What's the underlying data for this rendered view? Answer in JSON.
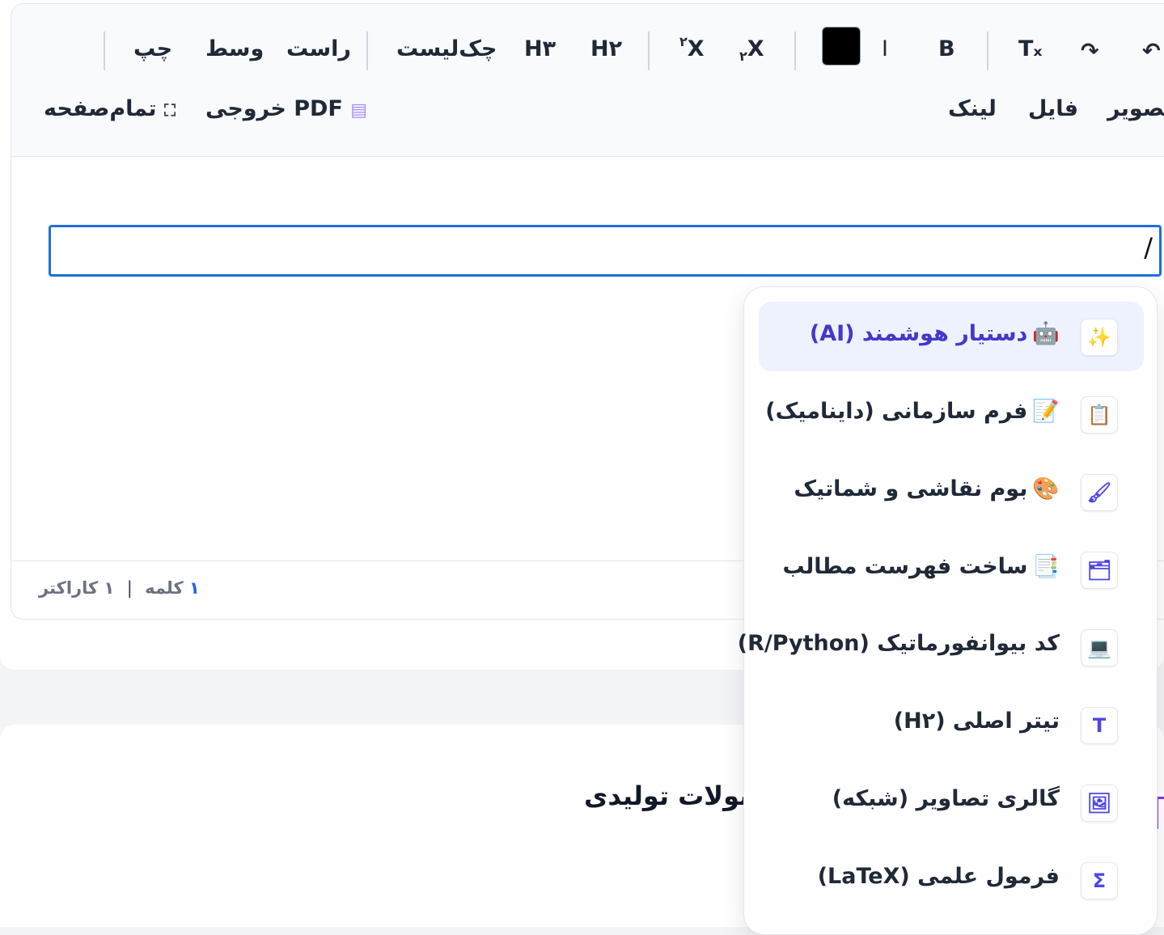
{
  "toolbar": {
    "row1": {
      "undo": "↶",
      "redo": "↷",
      "clear_format": "Tₓ",
      "bold": "B",
      "italic": "I",
      "subscript_base": "X",
      "subscript_mark": "۲",
      "superscript_base": "X",
      "superscript_mark": "۲",
      "h2": "H۲",
      "h3": "H۳",
      "checklist": "چک‌لیست",
      "align_right": "راست",
      "align_center": "وسط",
      "align_left": "چپ",
      "text_color": "#000000"
    },
    "row2": {
      "image": "تصویر",
      "file": "فایل",
      "link": "لینک",
      "export_pdf": "خروجی PDF",
      "fullscreen": "تمام‌صفحه"
    }
  },
  "editor": {
    "content": "/",
    "word_count_num": "۱",
    "word_count_label": "کلمه",
    "char_count": "۱ کاراکتر"
  },
  "slash_menu": {
    "items": [
      {
        "icon": "✨",
        "emoji": "🤖",
        "label": "دستیار هوشمند (AI)",
        "active": true
      },
      {
        "icon": "📋",
        "emoji": "📝",
        "label": "فرم سازمانی (داینامیک)"
      },
      {
        "icon": "🖌",
        "emoji": "🎨",
        "label": "بوم نقاشی و شماتیک"
      },
      {
        "icon": "🗂",
        "emoji": "📑",
        "label": "ساخت فهرست مطالب"
      },
      {
        "icon": "💻",
        "emoji": "",
        "label": "کد بیوانفورماتیک (R/Python)"
      },
      {
        "icon": "T",
        "emoji": "",
        "label": "تیتر اصلی (H۲)"
      },
      {
        "icon": "🖼",
        "emoji": "",
        "label": "گالری تصاویر (شبکه)"
      },
      {
        "icon": "Σ",
        "emoji": "",
        "label": "فرمول علمی (LaTeX)"
      }
    ]
  },
  "section": {
    "title": "سولات تولیدی"
  }
}
